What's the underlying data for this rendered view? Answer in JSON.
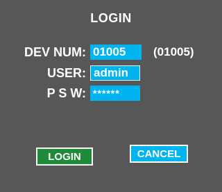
{
  "dialog": {
    "title": "LOGIN"
  },
  "form": {
    "dev_num": {
      "label": "DEV NUM:",
      "value": "01005",
      "hint": "(01005)"
    },
    "user": {
      "label": "USER:",
      "value": "admin"
    },
    "password": {
      "label": "P S W:",
      "value": "******"
    }
  },
  "buttons": {
    "login_label": "LOGIN",
    "cancel_label": "CANCEL"
  },
  "colors": {
    "panel_background": "#575757",
    "field_background": "#00b4f0",
    "login_button": "#1e8a3a",
    "cancel_button": "#00b4f0",
    "text": "#ffffff"
  }
}
